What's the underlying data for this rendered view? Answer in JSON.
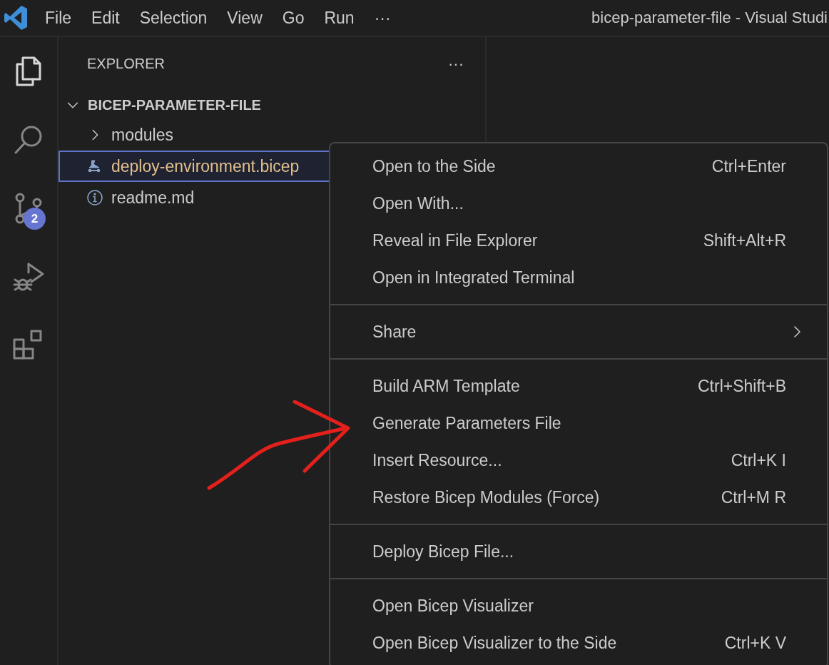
{
  "title_bar": {
    "menu": [
      "File",
      "Edit",
      "Selection",
      "View",
      "Go",
      "Run",
      "···"
    ],
    "title": "bicep-parameter-file - Visual Studi"
  },
  "activity_bar": {
    "items": [
      {
        "kind": "explorer",
        "selected": true
      },
      {
        "kind": "search",
        "selected": false
      },
      {
        "kind": "source_control",
        "selected": false,
        "badge": "2"
      },
      {
        "kind": "run_debug",
        "selected": false
      },
      {
        "kind": "extensions",
        "selected": false
      }
    ]
  },
  "sidebar": {
    "title": "EXPLORER",
    "more": "···",
    "folder": {
      "name": "BICEP-PARAMETER-FILE",
      "expanded": true,
      "children": [
        {
          "kind": "folder",
          "name": "modules",
          "expanded": false,
          "selected": false,
          "modified": false
        },
        {
          "kind": "bicep",
          "name": "deploy-environment.bicep",
          "selected": true,
          "modified": true
        },
        {
          "kind": "markdown",
          "name": "readme.md",
          "selected": false,
          "modified": false
        }
      ]
    }
  },
  "context_menu": {
    "groups": [
      [
        {
          "label": "Open to the Side",
          "shortcut": "Ctrl+Enter",
          "submenu": false
        },
        {
          "label": "Open With...",
          "submenu": false
        },
        {
          "label": "Reveal in File Explorer",
          "shortcut": "Shift+Alt+R",
          "submenu": false
        },
        {
          "label": "Open in Integrated Terminal",
          "submenu": false
        }
      ],
      [
        {
          "label": "Share",
          "submenu": true
        }
      ],
      [
        {
          "label": "Build ARM Template",
          "shortcut": "Ctrl+Shift+B",
          "submenu": false
        },
        {
          "label": "Generate Parameters File",
          "submenu": false
        },
        {
          "label": "Insert Resource...",
          "shortcut": "Ctrl+K I",
          "submenu": false
        },
        {
          "label": "Restore Bicep Modules (Force)",
          "shortcut": "Ctrl+M R",
          "submenu": false
        }
      ],
      [
        {
          "label": "Deploy Bicep File...",
          "submenu": false
        }
      ],
      [
        {
          "label": "Open Bicep Visualizer",
          "submenu": false
        },
        {
          "label": "Open Bicep Visualizer to the Side",
          "shortcut": "Ctrl+K V",
          "submenu": false
        }
      ]
    ]
  }
}
